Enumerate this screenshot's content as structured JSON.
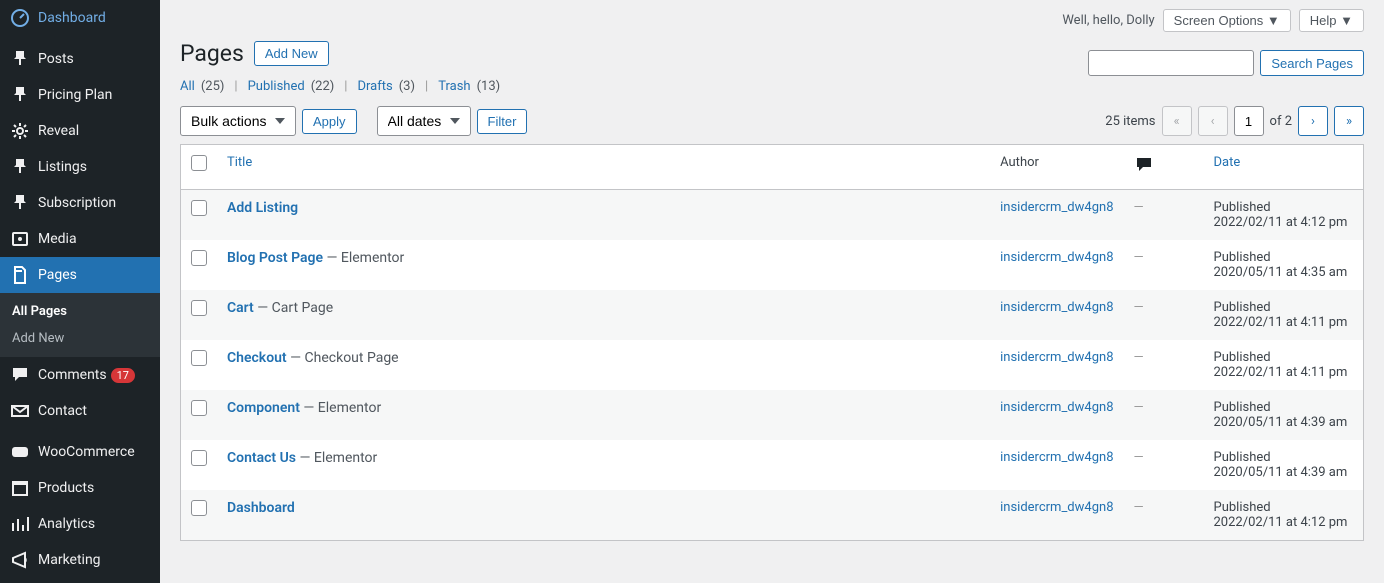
{
  "topbar": {
    "greeting": "Well, hello, Dolly",
    "screen_options": "Screen Options",
    "help": "Help"
  },
  "sidebar": {
    "items": [
      {
        "label": "Dashboard",
        "icon": "dashboard"
      },
      {
        "label": "Posts",
        "icon": "pin"
      },
      {
        "label": "Pricing Plan",
        "icon": "pin"
      },
      {
        "label": "Reveal",
        "icon": "gear"
      },
      {
        "label": "Listings",
        "icon": "pin"
      },
      {
        "label": "Subscription",
        "icon": "pin"
      },
      {
        "label": "Media",
        "icon": "media"
      },
      {
        "label": "Pages",
        "icon": "pages",
        "current": true
      },
      {
        "label": "Comments",
        "icon": "comment",
        "badge": "17"
      },
      {
        "label": "Contact",
        "icon": "mail"
      },
      {
        "label": "WooCommerce",
        "icon": "woo"
      },
      {
        "label": "Products",
        "icon": "archive"
      },
      {
        "label": "Analytics",
        "icon": "chart"
      },
      {
        "label": "Marketing",
        "icon": "mega"
      }
    ],
    "submenu": [
      {
        "label": "All Pages",
        "active": true
      },
      {
        "label": "Add New"
      }
    ]
  },
  "heading": {
    "title": "Pages",
    "add_new": "Add New"
  },
  "status_filters": {
    "all": "All",
    "all_count": "(25)",
    "published": "Published",
    "published_count": "(22)",
    "drafts": "Drafts",
    "drafts_count": "(3)",
    "trash": "Trash",
    "trash_count": "(13)"
  },
  "search": {
    "button": "Search Pages"
  },
  "actions": {
    "bulk": "Bulk actions",
    "apply": "Apply",
    "dates": "All dates",
    "filter": "Filter"
  },
  "pagination": {
    "items_label": "25 items",
    "current": "1",
    "of_label": "of 2"
  },
  "table": {
    "headers": {
      "title": "Title",
      "author": "Author",
      "date": "Date"
    },
    "rows": [
      {
        "title": "Add Listing",
        "suffix": "",
        "author": "insidercrm_dw4gn8",
        "comments": "—",
        "status": "Published",
        "date": "2022/02/11 at 4:12 pm"
      },
      {
        "title": "Blog Post Page",
        "suffix": " — Elementor",
        "author": "insidercrm_dw4gn8",
        "comments": "—",
        "status": "Published",
        "date": "2020/05/11 at 4:35 am"
      },
      {
        "title": "Cart",
        "suffix": " — Cart Page",
        "author": "insidercrm_dw4gn8",
        "comments": "—",
        "status": "Published",
        "date": "2022/02/11 at 4:11 pm"
      },
      {
        "title": "Checkout",
        "suffix": " — Checkout Page",
        "author": "insidercrm_dw4gn8",
        "comments": "—",
        "status": "Published",
        "date": "2022/02/11 at 4:11 pm"
      },
      {
        "title": "Component",
        "suffix": " — Elementor",
        "author": "insidercrm_dw4gn8",
        "comments": "—",
        "status": "Published",
        "date": "2020/05/11 at 4:39 am"
      },
      {
        "title": "Contact Us",
        "suffix": " — Elementor",
        "author": "insidercrm_dw4gn8",
        "comments": "—",
        "status": "Published",
        "date": "2020/05/11 at 4:39 am"
      },
      {
        "title": "Dashboard",
        "suffix": "",
        "author": "insidercrm_dw4gn8",
        "comments": "—",
        "status": "Published",
        "date": "2022/02/11 at 4:12 pm"
      }
    ]
  }
}
